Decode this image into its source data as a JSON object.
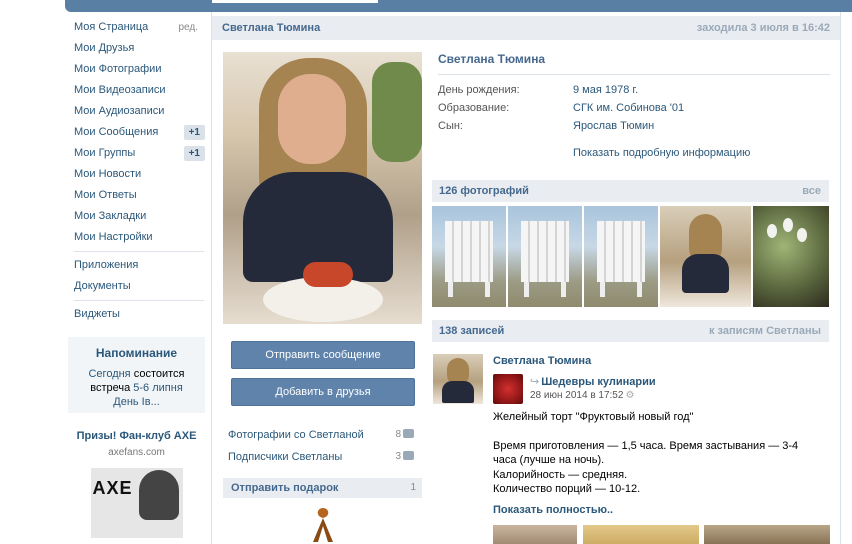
{
  "nav": {
    "items": [
      {
        "label": "Моя Страница",
        "edit": "ред.",
        "badge": ""
      },
      {
        "label": "Мои Друзья",
        "edit": "",
        "badge": ""
      },
      {
        "label": "Мои Фотографии",
        "edit": "",
        "badge": ""
      },
      {
        "label": "Мои Видеозаписи",
        "edit": "",
        "badge": ""
      },
      {
        "label": "Мои Аудиозаписи",
        "edit": "",
        "badge": ""
      },
      {
        "label": "Мои Сообщения",
        "edit": "",
        "badge": "+1"
      },
      {
        "label": "Мои Группы",
        "edit": "",
        "badge": "+1"
      },
      {
        "label": "Мои Новости",
        "edit": "",
        "badge": ""
      },
      {
        "label": "Мои Ответы",
        "edit": "",
        "badge": ""
      },
      {
        "label": "Мои Закладки",
        "edit": "",
        "badge": ""
      },
      {
        "label": "Мои Настройки",
        "edit": "",
        "badge": ""
      }
    ],
    "apps": [
      "Приложения",
      "Документы"
    ],
    "widgets": "Виджеты"
  },
  "reminder": {
    "title": "Напоминание",
    "today": "Сегодня",
    "text1": " состоится",
    "text2": "встреча ",
    "date": "5-6 липня",
    "event": "День Ів..."
  },
  "ad": {
    "title": "Призы! Фан-клуб AXE",
    "domain": "axefans.com",
    "logo": "AXE"
  },
  "header": {
    "name": "Светлана Тюмина",
    "status": "заходила 3 июля в 16:42"
  },
  "actions": {
    "send_message": "Отправить сообщение",
    "add_friend": "Добавить в друзья"
  },
  "side_links": [
    {
      "label": "Фотографии со Светланой",
      "count": "8"
    },
    {
      "label": "Подписчики Светланы",
      "count": "3"
    }
  ],
  "gift": {
    "title": "Отправить подарок",
    "count": "1"
  },
  "profile": {
    "name": "Светлана Тюмина",
    "rows": [
      {
        "label": "День рождения:",
        "value": "9 мая 1978 г."
      },
      {
        "label": "Образование:",
        "value": "СГК им. Собинова '01"
      },
      {
        "label": "Сын:",
        "value": "Ярослав Тюмин"
      }
    ],
    "more": "Показать подробную информацию"
  },
  "photos": {
    "title": "126 фотографий",
    "all": "все"
  },
  "wall": {
    "title": "138 записей",
    "link": "к записям Светланы",
    "post": {
      "author": "Светлана Тюмина",
      "repost_icon": "↪",
      "repost_name": "Шедевры кулинарии",
      "date": "28 июн 2014 в 17:52",
      "gear": "⚙",
      "lines": [
        "Желейный торт \"Фруктовый новый год\"",
        "",
        "Время приготовления — 1,5 часа. Время застывания — 3-4",
        "часа (лучше на ночь).",
        "Калорийность — средняя.",
        "Количество порций — 10-12."
      ],
      "show_more": "Показать полностью.."
    }
  }
}
